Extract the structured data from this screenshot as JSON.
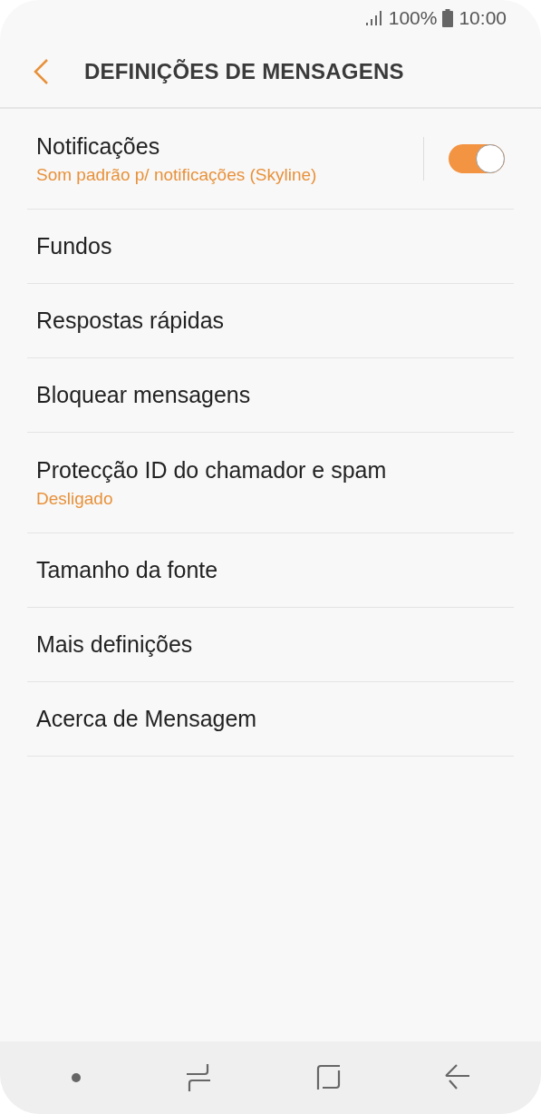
{
  "status_bar": {
    "battery": "100%",
    "time": "10:00"
  },
  "header": {
    "title": "DEFINIÇÕES DE MENSAGENS"
  },
  "settings": [
    {
      "kind": "toggle",
      "label": "Notificações",
      "summary": "Som padrão p/ notificações (Skyline)",
      "on": true
    },
    {
      "kind": "plain",
      "label": "Fundos"
    },
    {
      "kind": "plain",
      "label": "Respostas rápidas"
    },
    {
      "kind": "plain",
      "label": "Bloquear mensagens"
    },
    {
      "kind": "plain",
      "label": "Protecção ID do chamador e spam",
      "summary": "Desligado"
    },
    {
      "kind": "plain",
      "label": "Tamanho da fonte"
    },
    {
      "kind": "plain",
      "label": "Mais definições"
    },
    {
      "kind": "plain",
      "label": "Acerca de Mensagem"
    }
  ]
}
